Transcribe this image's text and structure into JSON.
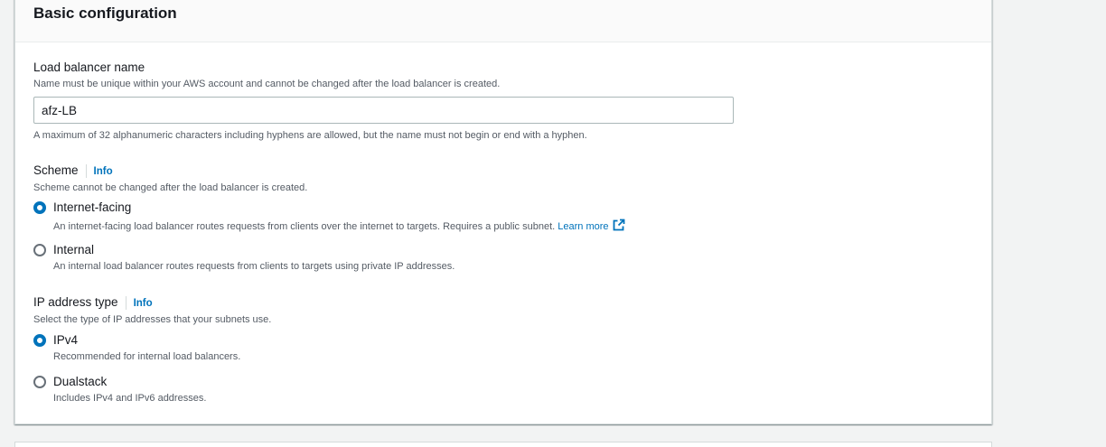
{
  "section": {
    "title": "Basic configuration"
  },
  "lb_name": {
    "label": "Load balancer name",
    "description": "Name must be unique within your AWS account and cannot be changed after the load balancer is created.",
    "value": "afz-LB",
    "constraint": "A maximum of 32 alphanumeric characters including hyphens are allowed, but the name must not begin or end with a hyphen."
  },
  "scheme": {
    "label": "Scheme",
    "info": "Info",
    "description": "Scheme cannot be changed after the load balancer is created.",
    "options": [
      {
        "label": "Internet-facing",
        "description": "An internet-facing load balancer routes requests from clients over the internet to targets. Requires a public subnet.",
        "link": "Learn more",
        "link_icon": "external-link-icon",
        "selected": true
      },
      {
        "label": "Internal",
        "description": "An internal load balancer routes requests from clients to targets using private IP addresses.",
        "selected": false
      }
    ]
  },
  "ip_type": {
    "label": "IP address type",
    "info": "Info",
    "description": "Select the type of IP addresses that your subnets use.",
    "options": [
      {
        "label": "IPv4",
        "description": "Recommended for internal load balancers.",
        "selected": true
      },
      {
        "label": "Dualstack",
        "description": "Includes IPv4 and IPv6 addresses.",
        "selected": false
      }
    ]
  },
  "colors": {
    "accent": "#0073bb",
    "text": "#16191f",
    "secondary_text": "#545b64",
    "background": "#f2f3f3"
  }
}
